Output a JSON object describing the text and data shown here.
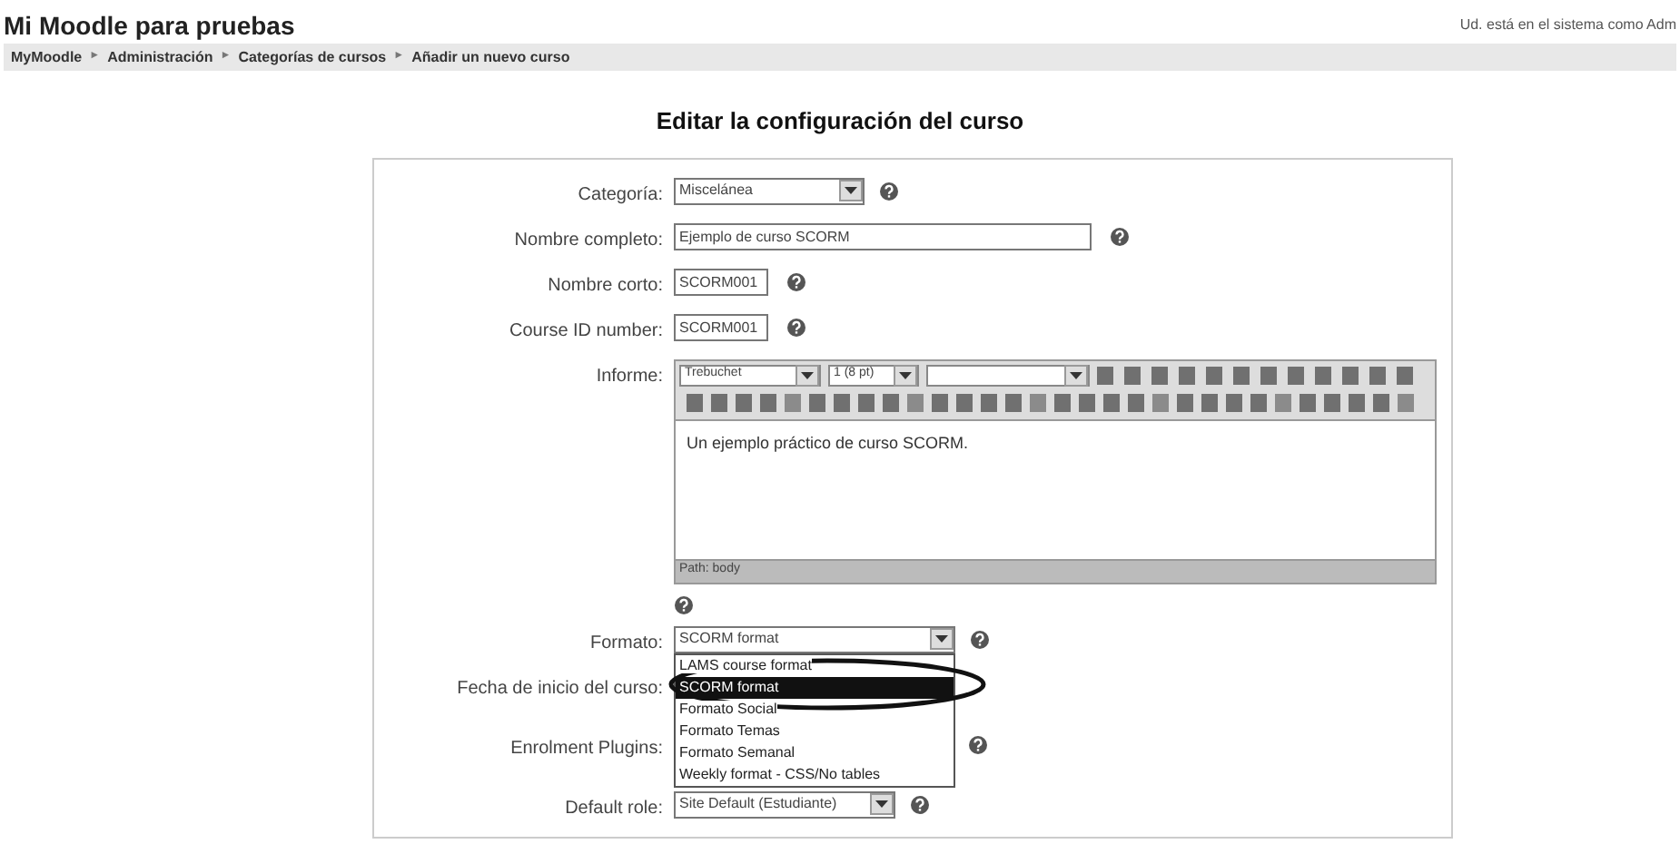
{
  "site_title": "Mi Moodle para pruebas",
  "login_info": "Ud. está en el sistema como Adm",
  "breadcrumb": {
    "separator": "►",
    "items": [
      "MyMoodle",
      "Administración",
      "Categorías de cursos",
      "Añadir un nuevo curso"
    ]
  },
  "heading": "Editar la configuración del curso",
  "fields": [
    {
      "kind": "select",
      "label": "Categoría:",
      "value": "Miscelánea"
    },
    {
      "kind": "text",
      "label": "Nombre completo:",
      "value": "Ejemplo de curso SCORM"
    },
    {
      "kind": "text",
      "label": "Nombre corto:",
      "value": "SCORM001"
    },
    {
      "kind": "text",
      "label": "Course ID number:",
      "value": "SCORM001"
    },
    {
      "kind": "editor",
      "label": "Informe:",
      "font": "Trebuchet",
      "size": "1 (8 pt)",
      "content": "Un ejemplo práctico de curso SCORM.",
      "path": "Path: body"
    },
    {
      "kind": "open_select",
      "label": "Formato:",
      "value": "SCORM format",
      "options": [
        {
          "label": "LAMS course format",
          "selected": false
        },
        {
          "label": "SCORM format",
          "selected": true
        },
        {
          "label": "Formato Social",
          "selected": false
        },
        {
          "label": "Formato Temas",
          "selected": false
        },
        {
          "label": "Formato Semanal",
          "selected": false
        },
        {
          "label": "Weekly format - CSS/No tables",
          "selected": false
        }
      ]
    },
    {
      "kind": "covered",
      "label": "Fecha de inicio del curso:"
    },
    {
      "kind": "covered_help",
      "label": "Enrolment Plugins:"
    },
    {
      "kind": "select",
      "label": "Default role:",
      "value": "Site Default (Estudiante)"
    }
  ]
}
